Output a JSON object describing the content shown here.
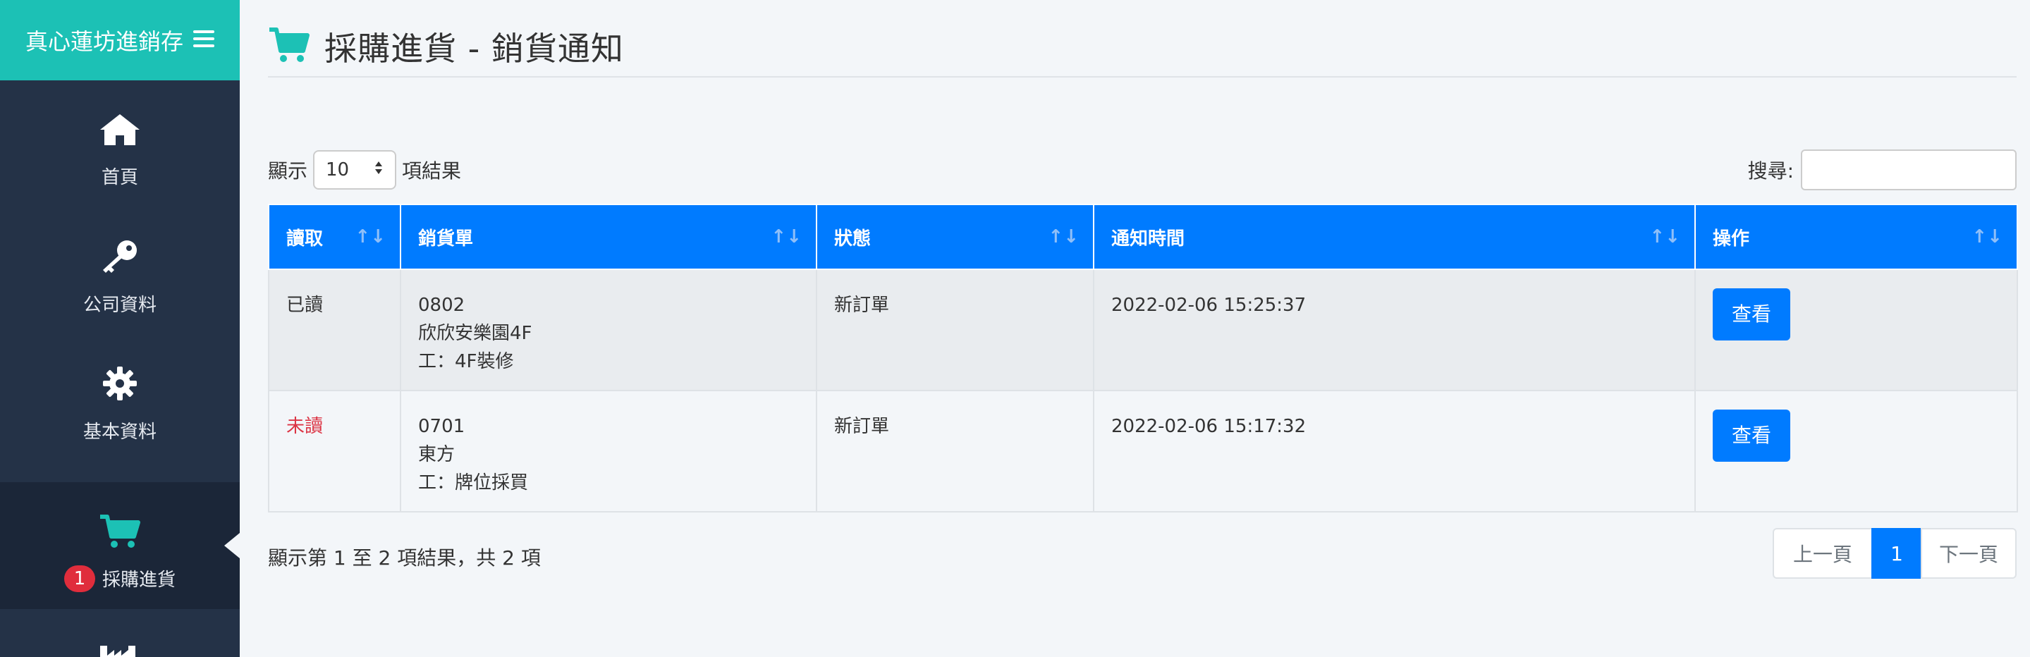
{
  "sidebar": {
    "brand": "真心蓮坊進銷存",
    "items": [
      {
        "label": "首頁",
        "icon": "home-icon"
      },
      {
        "label": "公司資料",
        "icon": "key-icon"
      },
      {
        "label": "基本資料",
        "icon": "gear-icon"
      },
      {
        "label": "採購進貨",
        "icon": "cart-icon",
        "badge": "1",
        "active": true
      },
      {
        "label": "",
        "icon": "factory-icon"
      }
    ]
  },
  "page": {
    "title": "採購進貨 - 銷貨通知",
    "title_icon": "cart-icon",
    "accent_color": "#1cc1b5"
  },
  "controls": {
    "length_prefix": "顯示",
    "length_value": "10",
    "length_suffix": "項結果",
    "search_label": "搜尋:",
    "search_value": ""
  },
  "table": {
    "header_color": "#007bff",
    "columns": [
      "讀取",
      "銷貨單",
      "狀態",
      "通知時間",
      "操作"
    ],
    "rows": [
      {
        "read": "已讀",
        "unread": false,
        "order_no": "0802",
        "customer": "欣欣安樂園4F",
        "work": "工：4F裝修",
        "status": "新訂單",
        "time": "2022-02-06 15:25:37",
        "action": "查看"
      },
      {
        "read": "未讀",
        "unread": true,
        "order_no": "0701",
        "customer": "東方",
        "work": "工：牌位採買",
        "status": "新訂單",
        "time": "2022-02-06 15:17:32",
        "action": "查看"
      }
    ]
  },
  "footer": {
    "info": "顯示第 1 至 2 項結果，共 2 項",
    "prev": "上一頁",
    "current_page": "1",
    "next": "下一頁"
  }
}
